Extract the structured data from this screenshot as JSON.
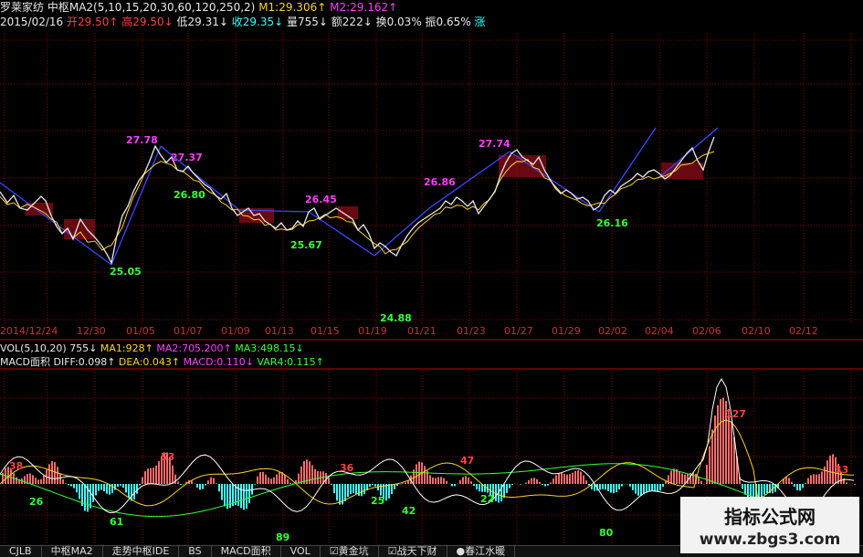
{
  "header": {
    "stock_name": "罗莱家纺",
    "indicator": "中枢MA2(5,10,15,20,30,60,120,250,2)",
    "m1": "M1:29.306",
    "m1_arrow": "↑",
    "m2": "M2:29.162",
    "m2_arrow": "↑",
    "date": "2015/02/16",
    "open": "开29.50",
    "open_arrow": "↑",
    "high": "高29.50",
    "high_arrow": "↓",
    "low": "低29.31",
    "low_arrow": "↓",
    "close": "收29.35",
    "close_arrow": "↓",
    "volume": "量755",
    "volume_arrow": "↓",
    "amount": "额222",
    "amount_arrow": "↓",
    "turnover": "换0.03%",
    "amplitude": "振0.65%",
    "rise": "涨"
  },
  "price_labels": [
    {
      "text": "27.78",
      "color": "#ff3cff"
    },
    {
      "text": "27.37",
      "color": "#ff3cff"
    },
    {
      "text": "26.80",
      "color": "#34ff34"
    },
    {
      "text": "25.05",
      "color": "#34ff34"
    },
    {
      "text": "26.45",
      "color": "#ff3cff"
    },
    {
      "text": "25.67",
      "color": "#34ff34"
    },
    {
      "text": "24.88",
      "color": "#34ff34"
    },
    {
      "text": "26.86",
      "color": "#ff3cff"
    },
    {
      "text": "27.74",
      "color": "#ff3cff"
    },
    {
      "text": "26.16",
      "color": "#34ff34"
    }
  ],
  "dates": [
    "2014/12/24",
    "12/30",
    "01/05",
    "01/07",
    "01/09",
    "01/13",
    "01/15",
    "01/19",
    "01/21",
    "01/23",
    "01/27",
    "01/29",
    "02/02",
    "02/04",
    "02/06",
    "02/10",
    "02/12"
  ],
  "volume_indicator": {
    "name": "VOL(5,10,20)",
    "value": "755",
    "value_arrow": "↓",
    "ma1": "MA1:928",
    "ma1_arrow": "↑",
    "ma2": "MA2:705.200",
    "ma2_arrow": "↑",
    "ma3": "MA3:498.15",
    "ma3_arrow": "↓"
  },
  "macd_indicator": {
    "name": "MACD面积",
    "diff": "DIFF:0.098",
    "diff_arrow": "↑",
    "dea": "DEA:0.043",
    "dea_arrow": "↑",
    "macd": "MACD:0.110",
    "macd_arrow": "↓",
    "var4": "VAR4:0.115",
    "var4_arrow": "↑"
  },
  "macd_labels": [
    {
      "text": "38",
      "color": "#ff4040"
    },
    {
      "text": "26",
      "color": "#34ff34"
    },
    {
      "text": "61",
      "color": "#34ff34"
    },
    {
      "text": "53",
      "color": "#ff4040"
    },
    {
      "text": "36",
      "color": "#ff4040"
    },
    {
      "text": "89",
      "color": "#34ff34"
    },
    {
      "text": "25",
      "color": "#34ff34"
    },
    {
      "text": "42",
      "color": "#34ff34"
    },
    {
      "text": "47",
      "color": "#ff4040"
    },
    {
      "text": "22",
      "color": "#34ff34"
    },
    {
      "text": "80",
      "color": "#34ff34"
    },
    {
      "text": "127",
      "color": "#ff4040"
    },
    {
      "text": "33",
      "color": "#ff4040"
    }
  ],
  "tabs": [
    "CJLB",
    "中枢MA2",
    "走势中枢IDE",
    "BS",
    "MACD面积",
    "VOL",
    "☑黄金坑",
    "☑战天下财",
    "●春江水暖"
  ],
  "watermark": {
    "title": "指标公式网",
    "url": "www.zbgs3.com"
  },
  "colors": {
    "grid": "#8a0000",
    "price_line": "#e8e8e8",
    "ma_line": "#ffd21e",
    "trend_line": "#3c46ff",
    "bar_pos": "#ff6a6a",
    "bar_neg": "#40ffff",
    "diff_line": "#ffffff",
    "dea_line": "#ffd21e",
    "var_line": "#34ff34"
  }
}
